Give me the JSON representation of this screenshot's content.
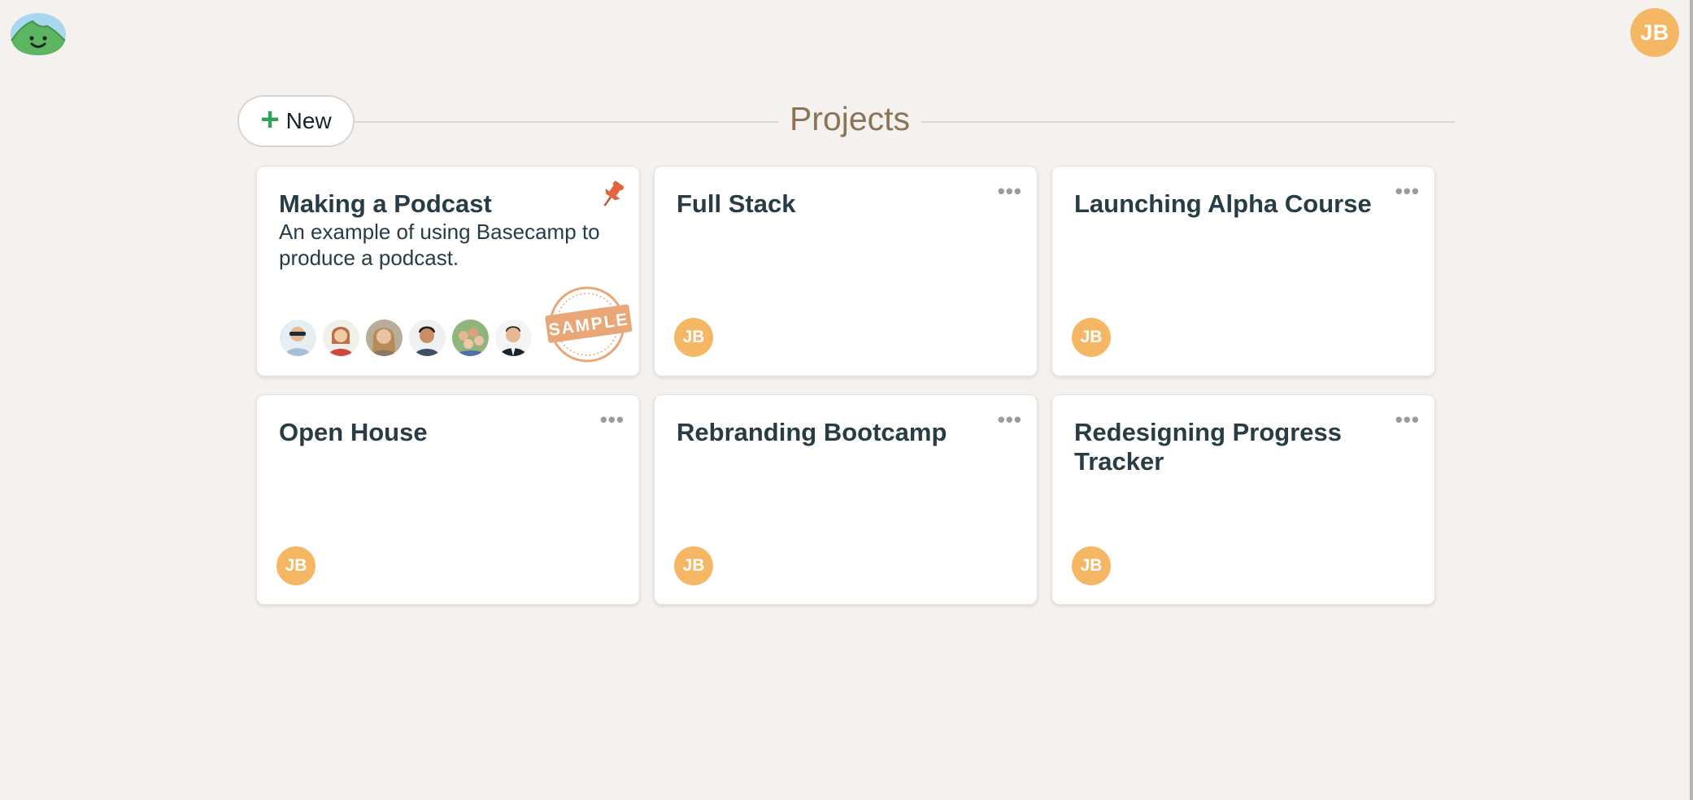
{
  "user": {
    "initials": "JB"
  },
  "header": {
    "new_button_label": "New",
    "title": "Projects"
  },
  "projects": [
    {
      "title": "Making a Podcast",
      "description": "An example of using Basecamp to produce a podcast.",
      "pinned": true,
      "badge": "SAMPLE"
    },
    {
      "title": "Full Stack",
      "member_initials": "JB"
    },
    {
      "title": "Launching Alpha Course",
      "member_initials": "JB"
    },
    {
      "title": "Open House",
      "member_initials": "JB"
    },
    {
      "title": "Rebranding Bootcamp",
      "member_initials": "JB"
    },
    {
      "title": "Redesigning Progress Tracker",
      "member_initials": "JB"
    }
  ],
  "icons": {
    "logo": "basecamp-logo-icon",
    "pin": "pin-icon",
    "more": "more-options-icon",
    "plus": "plus-icon"
  },
  "colors": {
    "background": "#f5f1ee",
    "avatar": "#f6b765",
    "title": "#8b7457",
    "plus": "#33a05c",
    "pin": "#e0653b",
    "sample_stamp": "#e9a676"
  }
}
